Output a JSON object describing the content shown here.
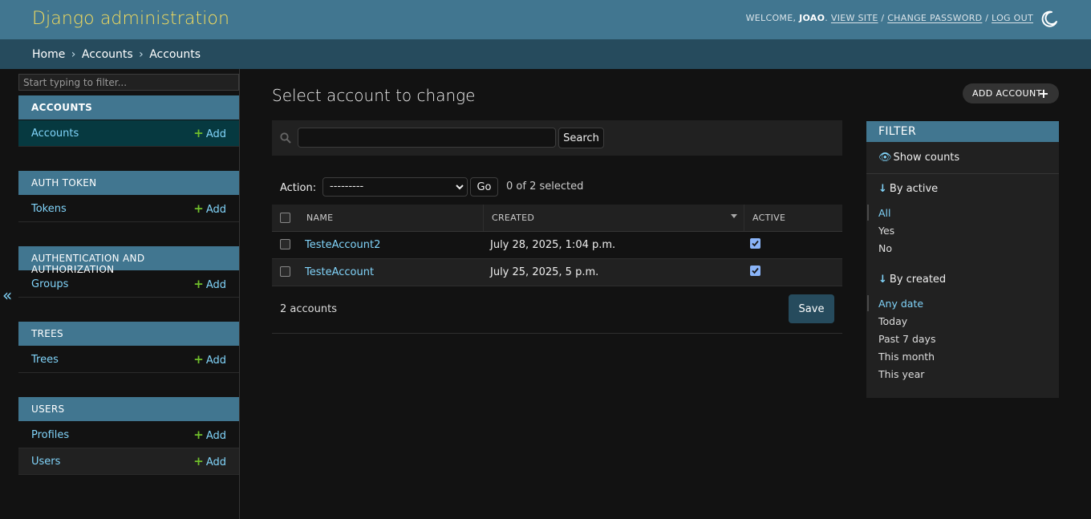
{
  "header": {
    "site_name": "Django administration",
    "welcome": "Welcome,",
    "username": "joao",
    "view_site": "View site",
    "change_password": "Change password",
    "log_out": "Log out",
    "sep": "/",
    "theme_icon": "moon-icon"
  },
  "breadcrumbs": {
    "home": "Home",
    "app": "Accounts",
    "model": "Accounts",
    "sep": "›"
  },
  "sidebar": {
    "filter_placeholder": "Start typing to filter...",
    "add_label": "Add",
    "apps": [
      {
        "caption": "Accounts",
        "models": [
          {
            "name": "Accounts"
          }
        ]
      },
      {
        "caption": "Auth Token",
        "models": [
          {
            "name": "Tokens"
          }
        ]
      },
      {
        "caption": "Authentication and Authorization",
        "models": [
          {
            "name": "Groups"
          }
        ]
      },
      {
        "caption": "Trees",
        "models": [
          {
            "name": "Trees"
          }
        ]
      },
      {
        "caption": "Users",
        "models": [
          {
            "name": "Profiles"
          },
          {
            "name": "Users"
          }
        ]
      }
    ],
    "collapse_glyph": "«"
  },
  "main": {
    "title": "Select account to change",
    "add_button": "Add Account",
    "search_button": "Search",
    "action_label": "Action:",
    "action_selected": "---------",
    "go_button": "Go",
    "selection_counter": "0 of 2 selected",
    "columns": [
      "Name",
      "Created",
      "Active"
    ],
    "rows": [
      {
        "name": "TesteAccount2",
        "created": "July 28, 2025, 1:04 p.m.",
        "active": true
      },
      {
        "name": "TesteAccount",
        "created": "July 25, 2025, 5 p.m.",
        "active": true
      }
    ],
    "result_count": "2 accounts",
    "save_button": "Save"
  },
  "filter": {
    "title": "Filter",
    "show_counts": "Show counts",
    "groups": [
      {
        "title": "By active",
        "choices": [
          "All",
          "Yes",
          "No"
        ],
        "selected": 0
      },
      {
        "title": "By created",
        "choices": [
          "Any date",
          "Today",
          "Past 7 days",
          "This month",
          "This year"
        ],
        "selected": 0
      }
    ]
  },
  "colors": {
    "header": "#417690",
    "breadcrumbs": "#264b5d",
    "brand_text": "#f5dd5d",
    "link": "#81d4fa",
    "add_plus": "#70bf2b",
    "background": "#121212"
  }
}
